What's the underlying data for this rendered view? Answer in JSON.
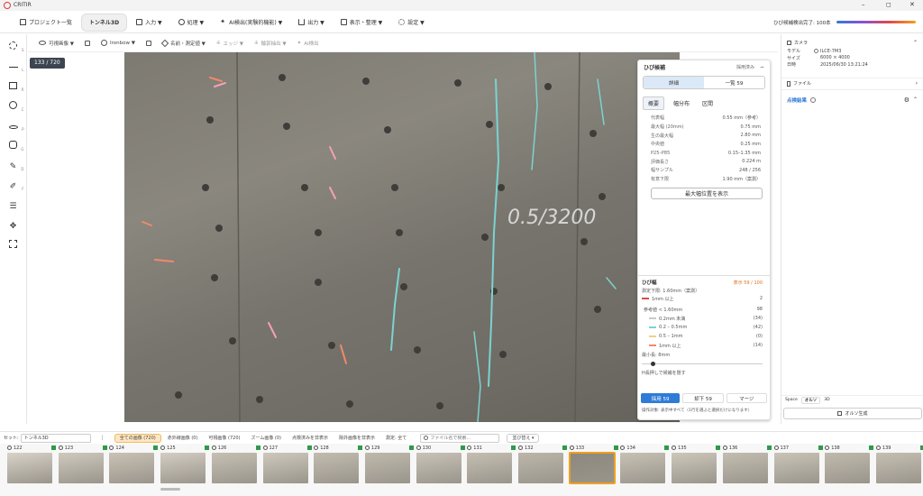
{
  "app": {
    "title": "CRITIR"
  },
  "window_controls": [
    "–",
    "◻",
    "✕"
  ],
  "menu": {
    "items": [
      {
        "label": "プロジェクト一覧",
        "icon": "home-icon"
      },
      {
        "label": "トンネル3D",
        "active": true
      },
      {
        "label": "入力 ▼",
        "icon": "import-icon"
      },
      {
        "label": "処理 ▼",
        "icon": "process-icon"
      },
      {
        "label": "AI検出(実験的機能) ▼",
        "icon": "ai-icon"
      },
      {
        "label": "出力 ▼",
        "icon": "export-icon"
      },
      {
        "label": "表示・整理 ▼",
        "icon": "view-icon"
      },
      {
        "label": "設定 ▼",
        "icon": "gear-icon"
      }
    ],
    "status": "ひび候補検出完了: 100本"
  },
  "view_toolbar": {
    "items": [
      "可視画像 ▼",
      "Ironbow ▼",
      "名前・測定値 ▼",
      "エッジ ▼",
      "輪郭抽出 ▼",
      "AI検出"
    ]
  },
  "left_tools": [
    {
      "name": "select-tool",
      "key": "S"
    },
    {
      "name": "line-tool",
      "key": "L"
    },
    {
      "name": "rect-tool",
      "key": "R"
    },
    {
      "name": "circle-tool",
      "key": "C"
    },
    {
      "name": "point-tool",
      "key": "P"
    },
    {
      "name": "polygon-tool",
      "key": "G"
    },
    {
      "name": "pen-tool",
      "key": "D"
    },
    {
      "name": "edit-tool",
      "key": "F"
    },
    {
      "name": "adjust-tool",
      "key": ""
    },
    {
      "name": "move-tool",
      "key": ""
    },
    {
      "name": "fit-tool",
      "key": ""
    }
  ],
  "counter": "133 / 720",
  "crack_panel": {
    "title": "ひび候補",
    "status": "採用済み",
    "collapse": "−",
    "tabs": [
      "詳細",
      "一覧 59"
    ],
    "subtabs": [
      "概要",
      "幅分布",
      "区間"
    ],
    "summary": [
      {
        "k": "代表幅",
        "v": "0.55 mm（参考）"
      },
      {
        "k": "最大幅 (20mm)",
        "v": "0.75 mm"
      },
      {
        "k": "生の最大幅",
        "v": "2.80 mm"
      },
      {
        "k": "中央値",
        "v": "0.25 mm"
      },
      {
        "k": "P25–P85",
        "v": "0.15–1.35 mm"
      },
      {
        "k": "評価長さ",
        "v": "0.224 m"
      },
      {
        "k": "幅サンプル",
        "v": "248 / 256"
      },
      {
        "k": "有意下限",
        "v": "1.90 mm（案測）"
      }
    ],
    "show_max_button": "最大幅位置を表示",
    "width_title": "ひび幅",
    "width_count": "表示 59 / 100",
    "threshold": "測定下限: 1.60mm（案測）",
    "over_label": "1mm 以上",
    "over_count": "2",
    "ref_label": "参考値 < 1.60mm",
    "ref_count": "98",
    "legend": [
      {
        "label": "0.2mm 未満",
        "count": "(34)",
        "color": "#c9c9c9"
      },
      {
        "label": "0.2 – 0.5mm",
        "count": "(42)",
        "color": "#7ad3d0"
      },
      {
        "label": "0.5 – 1mm",
        "count": "(0)",
        "color": "#f2d08a"
      },
      {
        "label": "1mm 以上",
        "count": "(14)",
        "color": "#f08a6a"
      }
    ],
    "min_len_label": "最小長: 8mm",
    "hide_label": "H長押しで候補を隠す",
    "bottom_tabs": [
      "採用 59",
      "却下 59",
      "マージ"
    ],
    "footer_note": "操作対象: 表示中すべて（1行を選ぶと選択だけになります）"
  },
  "right_panel": {
    "camera_title": "カメラ",
    "model_label": "モデル",
    "model_value": "ILCE-7M3",
    "size_label": "サイズ",
    "size_value": "6000 × 4000",
    "date_label": "日時",
    "date_value": "2025/06/30 13:21:24",
    "file_label": "ファイル",
    "results_title": "点検結果",
    "space_label": "Space",
    "space_tabs": [
      "オルソ",
      "3D"
    ],
    "ortho_button": "オルソ生成"
  },
  "filmstrip_bar": {
    "set_label": "セット:",
    "set_value": "トンネル3D",
    "filters": [
      {
        "label": "全ての画像 (720)",
        "active": true
      },
      {
        "label": "赤外線画像 (0)"
      },
      {
        "label": "可視画像 (720)"
      },
      {
        "label": "ズーム画像 (0)"
      },
      {
        "label": "点検済みを非表示"
      },
      {
        "label": "除外画像を非表示"
      },
      {
        "label": "測定: 全て"
      }
    ],
    "search_placeholder": "ファイル名で検索...",
    "sort_label": "並び替え ▾"
  },
  "thumbnails": [
    "122",
    "123",
    "124",
    "125",
    "126",
    "127",
    "128",
    "129",
    "130",
    "131",
    "132",
    "133",
    "134",
    "135",
    "136",
    "137",
    "138",
    "139"
  ],
  "selected_thumb": "133",
  "photo": {
    "annotation": "0.5/3200"
  },
  "colors": {
    "accent": "#2f7bd8",
    "selected_border": "#f0a020",
    "brand": "#e03838"
  }
}
